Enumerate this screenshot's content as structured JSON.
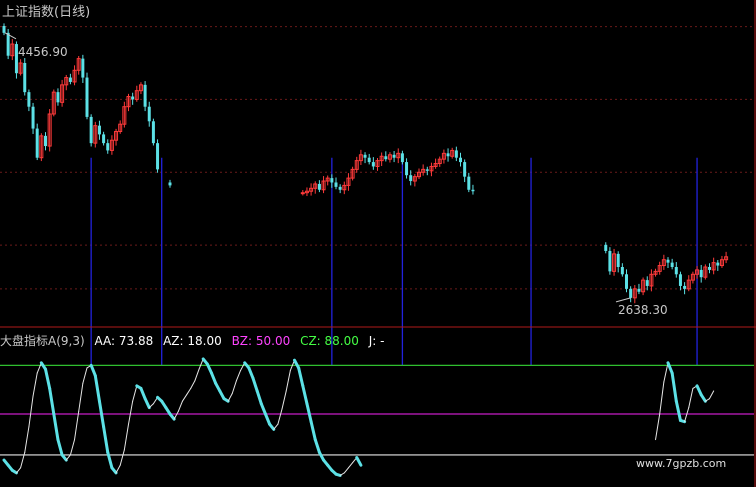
{
  "title": "上证指数(日线)",
  "indicator": {
    "name": "大盘指标A(9,3)",
    "aa_label": "AA: 73.88",
    "az_label": "AZ: 18.00",
    "bz_label": "BZ: 50.00",
    "cz_label": "CZ: 88.00",
    "j_label": "J: -",
    "colors": {
      "name": "#c8c8c8",
      "aa": "#ffffff",
      "az": "#ffffff",
      "bz": "#ff44ff",
      "cz": "#44ff44",
      "j": "#ffffff"
    }
  },
  "watermark": "www.7gpzb.com",
  "colors": {
    "up": "#ff3a3a",
    "down": "#5ce1e6",
    "signal": "#2222dd",
    "line88": "#2fbf2f",
    "line50": "#c61cc6",
    "line18": "#e8e8e8",
    "sep": "#b01a1a",
    "grid": "#6a1a1a"
  },
  "chart_data": [
    {
      "type": "candlestick",
      "title": "上证指数(日线)",
      "ylim": [
        2500,
        4600
      ],
      "annotations": [
        {
          "text": "4456.90",
          "value": 4456.9
        },
        {
          "text": "2638.30",
          "value": 2638.3
        }
      ],
      "segments": [
        {
          "start": 0,
          "closes": [
            4456.9,
            4300,
            4380,
            4180,
            4250,
            4050,
            3950,
            3800,
            3600,
            3750,
            3680,
            3900,
            4050,
            3980,
            4100,
            4150,
            4120,
            4200,
            4280,
            4150,
            3880,
            3700,
            3820,
            3760,
            3700,
            3650,
            3720,
            3780,
            3830,
            3950,
            4020,
            4000,
            4060,
            4100,
            3950,
            3850,
            3700,
            3520
          ]
        },
        {
          "start": 40,
          "closes": [
            3410
          ]
        },
        {
          "start": 72,
          "closes": [
            3360,
            3370,
            3390,
            3420,
            3380,
            3440,
            3460,
            3430,
            3400,
            3380,
            3410,
            3460,
            3520,
            3580,
            3620,
            3600,
            3570,
            3540,
            3580,
            3610,
            3590,
            3620,
            3600,
            3630,
            3570,
            3480,
            3440,
            3470,
            3500,
            3520,
            3510,
            3540,
            3560,
            3590,
            3630,
            3610,
            3650,
            3600,
            3570,
            3470,
            3380,
            3370
          ]
        },
        {
          "start": 145,
          "closes": [
            2960,
            2820,
            2940,
            2850,
            2800,
            2700,
            2638.3,
            2700,
            2680,
            2760,
            2720,
            2800,
            2820,
            2860,
            2900,
            2880,
            2850,
            2800,
            2720,
            2700,
            2760,
            2800,
            2830,
            2780,
            2850,
            2830,
            2880,
            2860,
            2900,
            2920
          ]
        }
      ],
      "signal_bars": [
        21,
        38,
        79,
        96,
        127,
        167
      ]
    },
    {
      "type": "line",
      "title": "大盘指标A(9,3)",
      "ylim": [
        0,
        100
      ],
      "reference_lines": [
        88,
        50,
        18
      ],
      "series": [
        {
          "name": "AA",
          "highlight_threshold": 50,
          "start": 0,
          "values": [
            14,
            10,
            6,
            4,
            8,
            20,
            40,
            64,
            82,
            90,
            85,
            70,
            50,
            30,
            18,
            14,
            18,
            30,
            52,
            74,
            86,
            88,
            80,
            60,
            40,
            20,
            8,
            4,
            10,
            22,
            42,
            60,
            72,
            70,
            62,
            55,
            58,
            63,
            60,
            55,
            50,
            46,
            52,
            60,
            65,
            70,
            76,
            85,
            93,
            89,
            82,
            74,
            68,
            62,
            60,
            66,
            76,
            84,
            90,
            86,
            78,
            68,
            58,
            50,
            42,
            38,
            42,
            54,
            68,
            84,
            92,
            86,
            72,
            58,
            44,
            30,
            20,
            14,
            10,
            6,
            3,
            2,
            4,
            8,
            12,
            16,
            10
          ]
        },
        {
          "name": "AA-2",
          "highlight_threshold": 50,
          "start": 157,
          "values": [
            30,
            50,
            75,
            90,
            82,
            60,
            45,
            44,
            55,
            70,
            72,
            65,
            60,
            62,
            68
          ]
        }
      ]
    }
  ]
}
